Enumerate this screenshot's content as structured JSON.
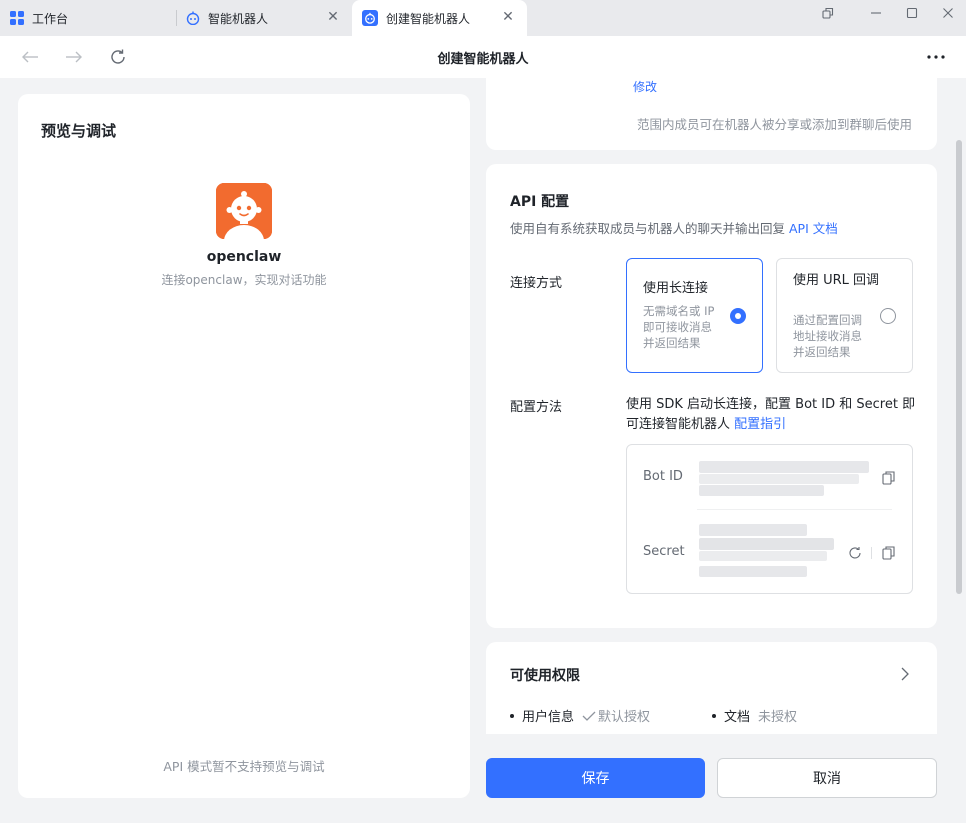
{
  "tabs": [
    {
      "label": "工作台",
      "icon": "grid-apps-icon"
    },
    {
      "label": "智能机器人",
      "icon": "bot-icon"
    },
    {
      "label": "创建智能机器人",
      "icon": "bot-icon",
      "active": true
    }
  ],
  "nav": {
    "title": "创建智能机器人"
  },
  "preview": {
    "title": "预览与调试",
    "bot_name": "openclaw",
    "bot_desc": "连接openclaw，实现对话功能",
    "note": "API 模式暂不支持预览与调试"
  },
  "scope_card": {
    "modify_link": "修改",
    "note": "范围内成员可在机器人被分享或添加到群聊后使用"
  },
  "api_config": {
    "title": "API 配置",
    "desc": "使用自有系统获取成员与机器人的聊天并输出回复",
    "doc_link": "API 文档",
    "connection_label": "连接方式",
    "options": [
      {
        "title": "使用长连接",
        "desc": "无需域名或 IP 即可接收消息并返回结果",
        "selected": true
      },
      {
        "title": "使用 URL 回调",
        "desc": "通过配置回调地址接收消息并返回结果",
        "selected": false
      }
    ],
    "method_label": "配置方法",
    "method_text": "使用 SDK 启动长连接，配置 Bot ID 和 Secret 即可连接智能机器人",
    "method_link": "配置指引",
    "bot_id_label": "Bot ID",
    "secret_label": "Secret"
  },
  "permissions": {
    "title": "可使用权限",
    "items": [
      {
        "label": "用户信息",
        "status": "默认授权",
        "checked": true
      },
      {
        "label": "文档",
        "status": "未授权",
        "checked": false
      }
    ]
  },
  "actions": {
    "save": "保存",
    "cancel": "取消"
  },
  "colors": {
    "accent": "#3370ff",
    "avatar_bg": "#f26b2f"
  }
}
